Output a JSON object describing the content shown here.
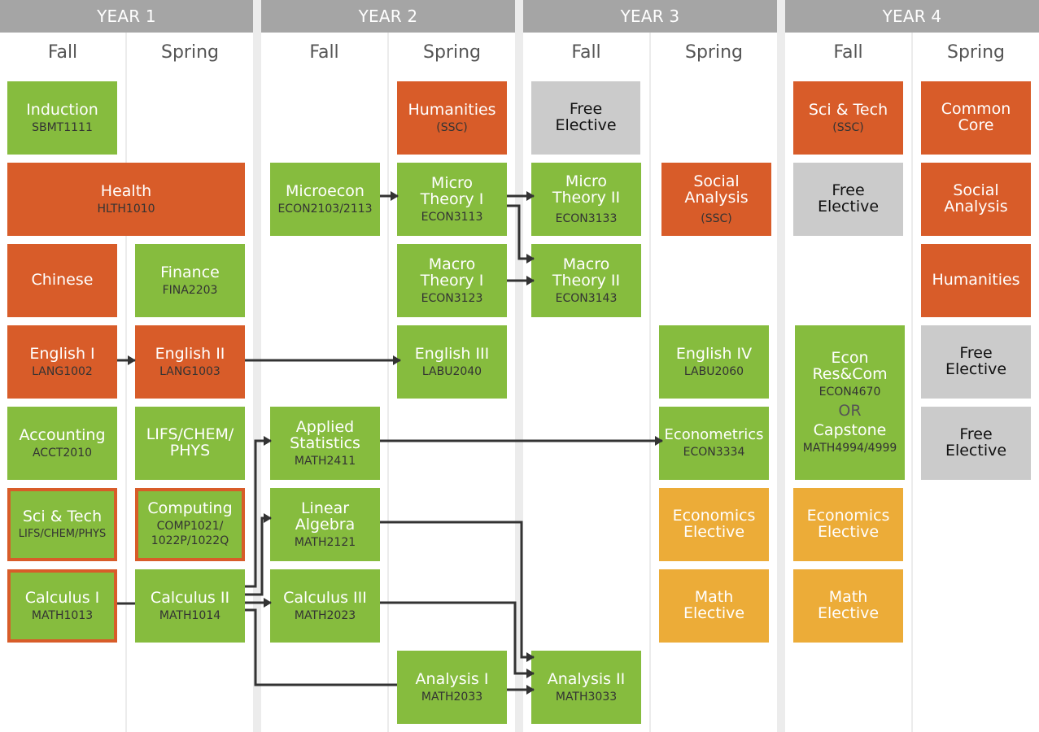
{
  "years": [
    {
      "label": "YEAR 1",
      "semesters": [
        "Fall",
        "Spring"
      ]
    },
    {
      "label": "YEAR 2",
      "semesters": [
        "Fall",
        "Spring"
      ]
    },
    {
      "label": "YEAR 3",
      "semesters": [
        "Fall",
        "Spring"
      ]
    },
    {
      "label": "YEAR 4",
      "semesters": [
        "Fall",
        "Spring"
      ]
    }
  ],
  "colors": {
    "required": "#86bc3e",
    "common_core": "#d85c29",
    "free_elective": "#cbcbcb",
    "major_elective": "#ecac38",
    "header": "#a5a5a5",
    "connector": "#333333"
  },
  "courses": {
    "induction": {
      "title": "Induction",
      "code": "SBMT1111"
    },
    "health": {
      "title": "Health",
      "code": "HLTH1010"
    },
    "chinese": {
      "title": "Chinese"
    },
    "english1": {
      "title": "English I",
      "code": "LANG1002"
    },
    "accounting": {
      "title": "Accounting",
      "code": "ACCT2010"
    },
    "scitech1": {
      "title": "Sci & Tech",
      "code": "LIFS/CHEM/PHYS"
    },
    "calculus1": {
      "title": "Calculus I",
      "code": "MATH1013"
    },
    "finance": {
      "title": "Finance",
      "code": "FINA2203"
    },
    "english2": {
      "title": "English II",
      "code": "LANG1003"
    },
    "lifs": {
      "title": "LIFS/CHEM/ PHYS"
    },
    "computing": {
      "title": "Computing",
      "code": "COMP1021/ 1022P/1022Q"
    },
    "calculus2": {
      "title": "Calculus II",
      "code": "MATH1014"
    },
    "microecon": {
      "title": "Microecon",
      "code": "ECON2103/2113"
    },
    "appliedstats": {
      "title": "Applied Statistics",
      "code": "MATH2411"
    },
    "linalg": {
      "title": "Linear Algebra",
      "code": "MATH2121"
    },
    "calculus3": {
      "title": "Calculus III",
      "code": "MATH2023"
    },
    "humanities2": {
      "title": "Humanities",
      "code": "(SSC)"
    },
    "micro1": {
      "title": "Micro Theory I",
      "code": "ECON3113"
    },
    "macro1": {
      "title": "Macro Theory I",
      "code": "ECON3123"
    },
    "english3": {
      "title": "English III",
      "code": "LABU2040"
    },
    "analysis1": {
      "title": "Analysis I",
      "code": "MATH2033"
    },
    "free3": {
      "title": "Free Elective"
    },
    "micro2": {
      "title": "Micro Theory II",
      "code": "ECON3133"
    },
    "macro2": {
      "title": "Macro Theory II",
      "code": "ECON3143"
    },
    "analysis2": {
      "title": "Analysis II",
      "code": "MATH3033"
    },
    "social3": {
      "title": "Social Analysis",
      "code": "(SSC)"
    },
    "english4": {
      "title": "English IV",
      "code": "LABU2060"
    },
    "econometrics": {
      "title": "Econometrics",
      "code": "ECON3334"
    },
    "econelec3": {
      "title": "Economics Elective"
    },
    "mathelec3": {
      "title": "Math Elective"
    },
    "scitech4": {
      "title": "Sci & Tech",
      "code": "(SSC)"
    },
    "free4a": {
      "title": "Free Elective"
    },
    "capstone": {
      "title": "Econ Res&Com",
      "code": "ECON4670",
      "or": "OR",
      "title2": "Capstone",
      "code2": "MATH4994/4999"
    },
    "econelec4": {
      "title": "Economics Elective"
    },
    "mathelec4": {
      "title": "Math Elective"
    },
    "commoncore": {
      "title": "Common Core"
    },
    "social4": {
      "title": "Social Analysis"
    },
    "humanities4": {
      "title": "Humanities"
    },
    "free4b": {
      "title": "Free Elective"
    },
    "free4c": {
      "title": "Free Elective"
    }
  },
  "prerequisites": [
    [
      "english1",
      "english2"
    ],
    [
      "english2",
      "english3"
    ],
    [
      "calculus1",
      "calculus2"
    ],
    [
      "calculus2",
      "appliedstats"
    ],
    [
      "calculus2",
      "linalg"
    ],
    [
      "calculus2",
      "calculus3"
    ],
    [
      "calculus2",
      "analysis1"
    ],
    [
      "microecon",
      "micro1"
    ],
    [
      "micro1",
      "micro2"
    ],
    [
      "micro1",
      "macro2"
    ],
    [
      "macro1",
      "macro2"
    ],
    [
      "appliedstats",
      "econometrics"
    ],
    [
      "linalg",
      "analysis2"
    ],
    [
      "calculus3",
      "analysis2"
    ],
    [
      "analysis1",
      "analysis2"
    ]
  ]
}
